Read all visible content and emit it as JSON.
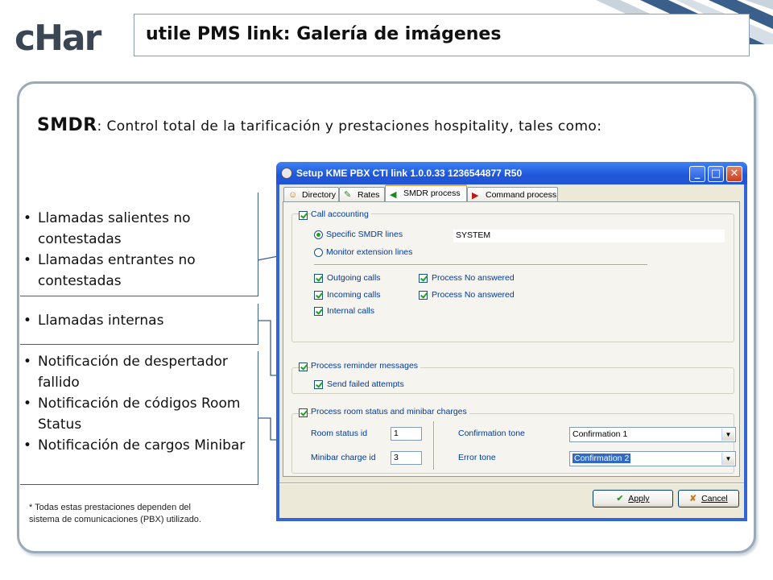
{
  "header": {
    "logo_text": "cHar",
    "title": "utile PMS link: Galería de imágenes"
  },
  "heading": {
    "bold": "SMDR",
    "rest": ": Control total de la tarificación y prestaciones hospitality, tales como:"
  },
  "features": {
    "group1": [
      "Llamadas salientes no contestadas",
      "Llamadas entrantes no contestadas"
    ],
    "group2": [
      "Llamadas internas"
    ],
    "group3": [
      "Notificación de despertador fallido",
      "Notificación de códigos Room Status",
      "Notificación de cargos Minibar"
    ]
  },
  "footnote": [
    "* Todas estas prestaciones dependen del",
    "sistema de comunicaciones (PBX) utilizado."
  ],
  "window": {
    "title": "Setup KME PBX CTI link 1.0.0.33  1236544877 R50",
    "controls": {
      "minimize": "_",
      "maximize": "□",
      "close": "✕"
    },
    "tabs": [
      {
        "label": "Directory",
        "icon": "people-icon"
      },
      {
        "label": "Rates",
        "icon": "rates-icon"
      },
      {
        "label": "SMDR process",
        "icon": "arrow-left-icon",
        "active": true
      },
      {
        "label": "Command process",
        "icon": "arrow-right-icon"
      }
    ],
    "call_accounting": {
      "label": "Call accounting",
      "checked": true,
      "radio_specific": "Specific SMDR lines",
      "radio_monitor": "Monitor extension lines",
      "selected_radio": "Specific SMDR lines",
      "smdr_lines_value": "SYSTEM",
      "outgoing": "Outgoing calls",
      "incoming": "Incoming calls",
      "internal": "Internal calls",
      "process_no_answered_1": "Process No answered",
      "process_no_answered_2": "Process No answered"
    },
    "reminder": {
      "label": "Process reminder messages",
      "send_failed": "Send failed attempts"
    },
    "room_status": {
      "label": "Process room status and minibar charges",
      "room_status_id_label": "Room status id",
      "room_status_id_value": "1",
      "minibar_id_label": "Minibar charge id",
      "minibar_id_value": "3",
      "confirmation_tone_label": "Confirmation tone",
      "confirmation_tone_value": "Confirmation 1",
      "error_tone_label": "Error tone",
      "error_tone_value": "Confirmation 2"
    },
    "buttons": {
      "apply": "Apply",
      "cancel": "Cancel"
    }
  },
  "colors": {
    "accent": "#1f55d8",
    "panel_border": "#9aaab8",
    "logo": "#3b4654"
  }
}
